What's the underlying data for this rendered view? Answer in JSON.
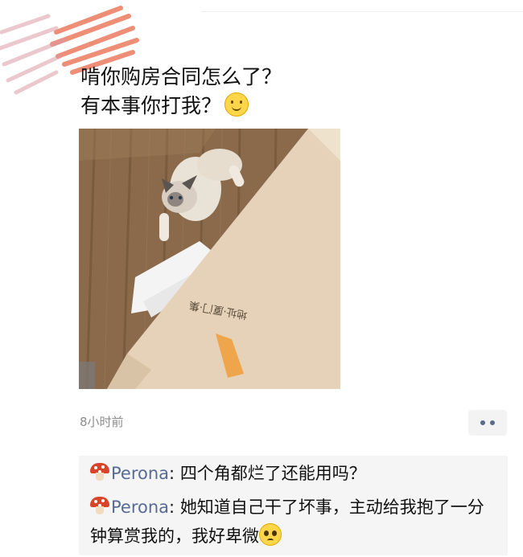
{
  "post": {
    "line1": "啃你购房合同怎么了？",
    "line2": "有本事你打我？",
    "time": "8小时前"
  },
  "icons": {
    "smile": "slightly-smiling-face-emoji",
    "mushroom": "mushroom-emoji",
    "pleading": "pleading-face-emoji",
    "more": "more-dots-icon"
  },
  "photo_text": {
    "envelope_print": "地址·厦门·集"
  },
  "comments": [
    {
      "name": "Perona",
      "sep": ": ",
      "text": "四个角都烂了还能用吗？"
    },
    {
      "name": "Perona",
      "sep": ": ",
      "text": "她知道自己干了坏事，主动给我抱了一分钟算赏我的，我好卑微"
    }
  ],
  "colors": {
    "name_link": "#576b95",
    "comment_bg": "#f5f5f5",
    "time": "#8c8c8c"
  }
}
